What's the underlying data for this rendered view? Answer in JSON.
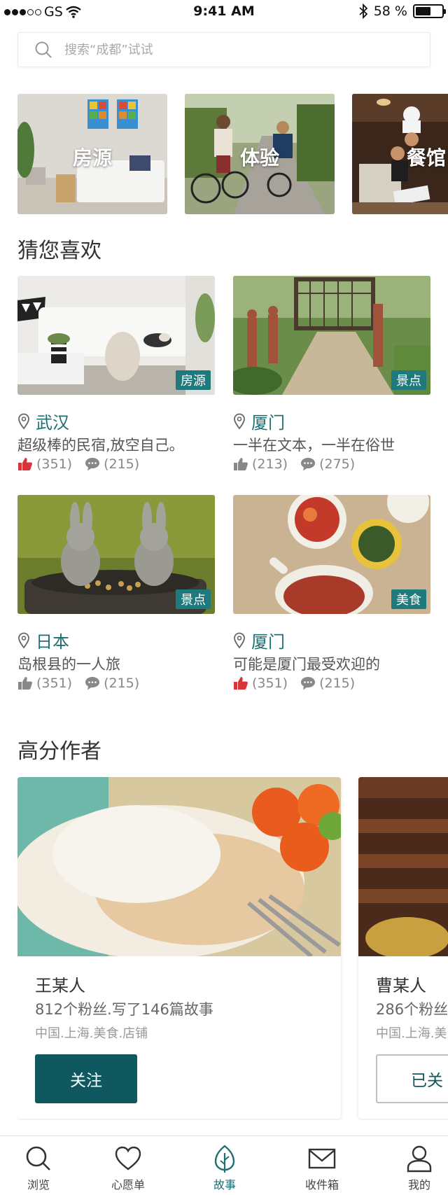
{
  "status_bar": {
    "carrier": "GS",
    "time": "9:41 AM",
    "battery": "58 %",
    "battery_level": 0.58
  },
  "search": {
    "placeholder": "搜索“成都”试试"
  },
  "categories": [
    {
      "label": "房源"
    },
    {
      "label": "体验"
    },
    {
      "label": "餐馆"
    }
  ],
  "recommend": {
    "title": "猜您喜欢",
    "items": [
      {
        "badge": "房源",
        "location": "武汉",
        "desc": "超级棒的民宿,放空自己。",
        "likes": "(351)",
        "comments": "(215)",
        "liked": true
      },
      {
        "badge": "景点",
        "location": "厦门",
        "desc": "一半在文本，一半在俗世",
        "likes": "(213)",
        "comments": "(275)",
        "liked": false
      },
      {
        "badge": "景点",
        "location": "日本",
        "desc": "岛根县的一人旅",
        "likes": "(351)",
        "comments": "(215)",
        "liked": false
      },
      {
        "badge": "美食",
        "location": "厦门",
        "desc": "可能是厦门最受欢迎的",
        "likes": "(351)",
        "comments": "(215)",
        "liked": true
      }
    ]
  },
  "authors": {
    "title": "高分作者",
    "items": [
      {
        "name": "王某人",
        "fans": "812个粉丝.写了146篇故事",
        "tags": "中国.上海.美食.店铺",
        "button": "关注"
      },
      {
        "name": "曹某人",
        "fans": "286个粉丝.写了",
        "tags": "中国.上海.美",
        "button": "已关"
      }
    ]
  },
  "tabs": [
    {
      "label": "浏览",
      "icon": "search-icon"
    },
    {
      "label": "心愿单",
      "icon": "heart-icon"
    },
    {
      "label": "故事",
      "icon": "leaf-icon",
      "active": true
    },
    {
      "label": "收件箱",
      "icon": "mail-icon"
    },
    {
      "label": "我的",
      "icon": "user-icon"
    }
  ],
  "colors": {
    "accent": "#1e6f72",
    "button": "#0f5860",
    "like_red": "#d9343a",
    "badge": "#1e7a7c"
  }
}
